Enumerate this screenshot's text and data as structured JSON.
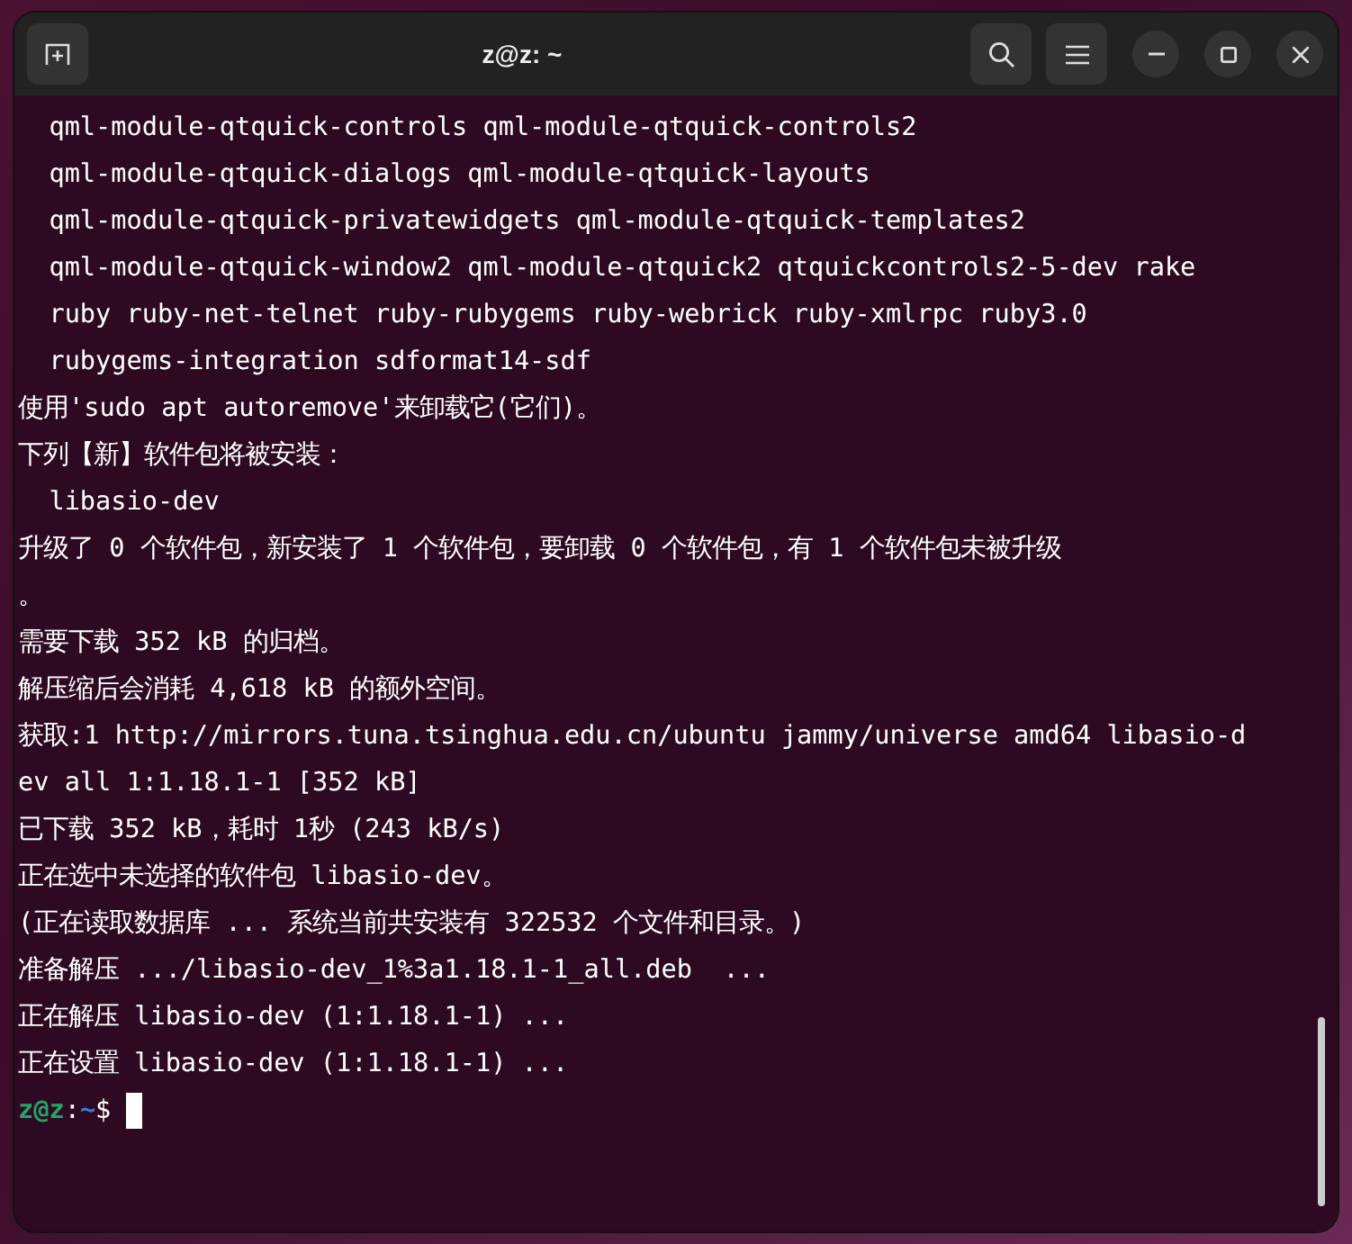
{
  "window": {
    "title": "z@z: ~"
  },
  "output_lines": [
    "  qml-module-qtquick-controls qml-module-qtquick-controls2",
    "  qml-module-qtquick-dialogs qml-module-qtquick-layouts",
    "  qml-module-qtquick-privatewidgets qml-module-qtquick-templates2",
    "  qml-module-qtquick-window2 qml-module-qtquick2 qtquickcontrols2-5-dev rake",
    "  ruby ruby-net-telnet ruby-rubygems ruby-webrick ruby-xmlrpc ruby3.0",
    "  rubygems-integration sdformat14-sdf",
    "使用'sudo apt autoremove'来卸载它(它们)。",
    "下列【新】软件包将被安装：",
    "  libasio-dev",
    "升级了 0 个软件包，新安装了 1 个软件包，要卸载 0 个软件包，有 1 个软件包未被升级",
    "。",
    "需要下载 352 kB 的归档。",
    "解压缩后会消耗 4,618 kB 的额外空间。",
    "获取:1 http://mirrors.tuna.tsinghua.edu.cn/ubuntu jammy/universe amd64 libasio-d",
    "ev all 1:1.18.1-1 [352 kB]",
    "已下载 352 kB，耗时 1秒 (243 kB/s)",
    "正在选中未选择的软件包 libasio-dev。",
    "(正在读取数据库 ... 系统当前共安装有 322532 个文件和目录。)",
    "准备解压 .../libasio-dev_1%3a1.18.1-1_all.deb  ...",
    "正在解压 libasio-dev (1:1.18.1-1) ...",
    "正在设置 libasio-dev (1:1.18.1-1) ..."
  ],
  "prompt": {
    "user_host": "z@z",
    "separator": ":",
    "path": "~",
    "symbol": "$"
  }
}
